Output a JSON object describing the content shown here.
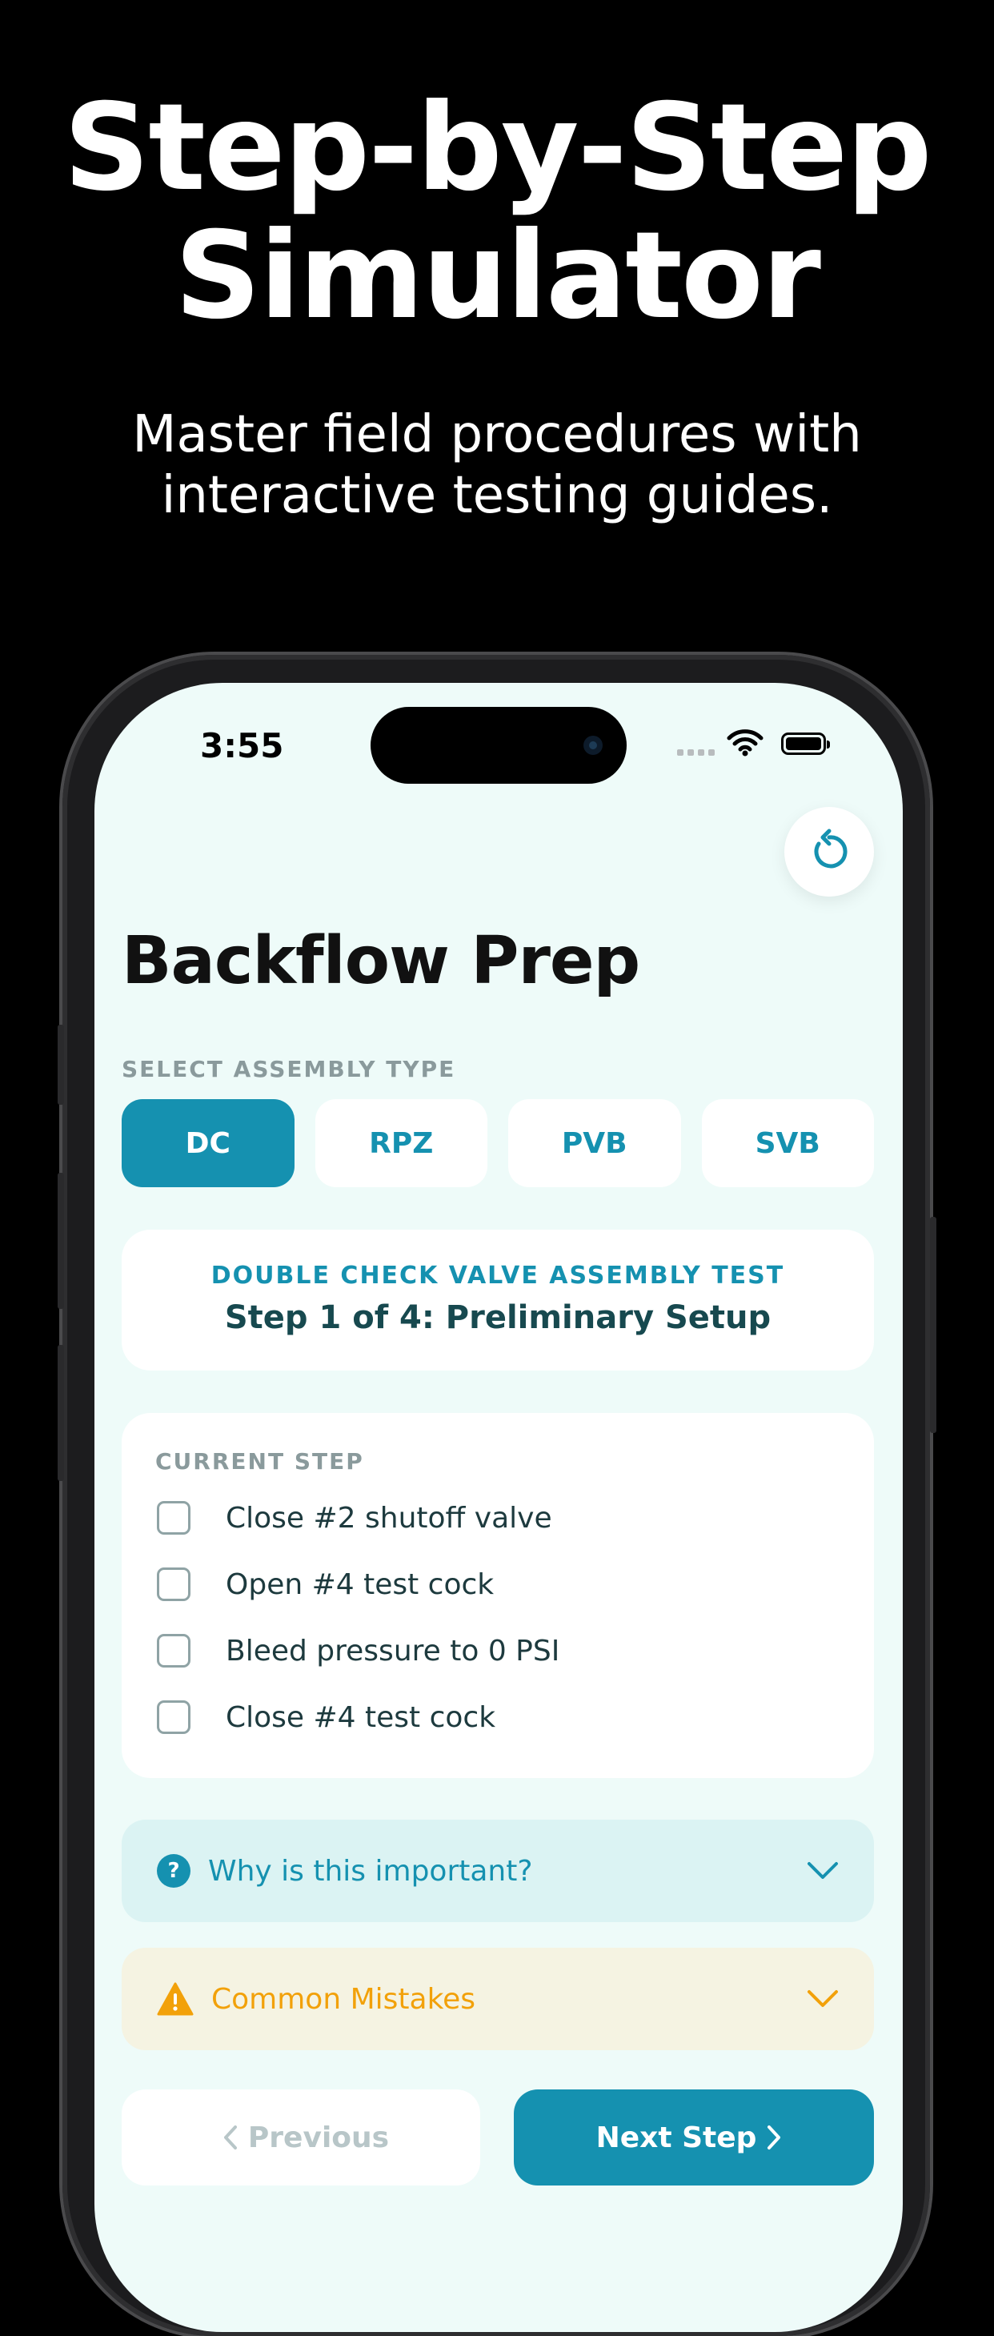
{
  "marketing": {
    "headline_line1": "Step-by-Step",
    "headline_line2": "Simulator",
    "subhead_line1": "Master field procedures with",
    "subhead_line2": "interactive testing guides."
  },
  "status_bar": {
    "time": "3:55"
  },
  "screen": {
    "title": "Backflow Prep",
    "assembly_section_label": "SELECT ASSEMBLY TYPE",
    "assembly_types": [
      {
        "label": "DC",
        "selected": true
      },
      {
        "label": "RPZ",
        "selected": false
      },
      {
        "label": "PVB",
        "selected": false
      },
      {
        "label": "SVB",
        "selected": false
      }
    ],
    "test_card": {
      "kicker": "DOUBLE CHECK VALVE ASSEMBLY TEST",
      "step_title": "Step 1 of 4: Preliminary Setup"
    },
    "current_step": {
      "label": "CURRENT STEP",
      "items": [
        {
          "text": "Close #2 shutoff valve",
          "checked": false
        },
        {
          "text": "Open #4 test cock",
          "checked": false
        },
        {
          "text": "Bleed pressure to 0 PSI",
          "checked": false
        },
        {
          "text": "Close #4 test cock",
          "checked": false
        }
      ]
    },
    "accordions": {
      "why_label": "Why is this important?",
      "mistakes_label": "Common Mistakes"
    },
    "navigation": {
      "previous_label": "Previous",
      "next_label": "Next Step"
    }
  },
  "colors": {
    "accent": "#1591b0",
    "screen_bg": "#eefbf9",
    "warning": "#f2a10a"
  },
  "icons": {
    "reset": "reset-icon",
    "question": "question-circle-icon",
    "warning": "warning-triangle-icon",
    "chevron": "chevron-down-icon"
  }
}
